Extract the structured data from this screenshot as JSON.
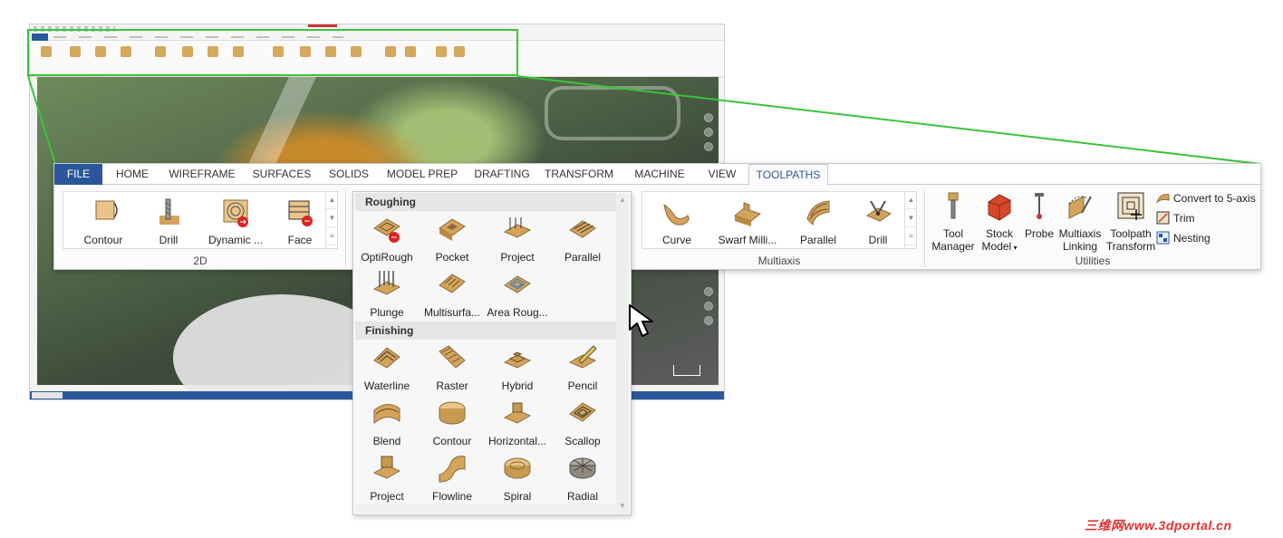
{
  "tabs": [
    "FILE",
    "HOME",
    "WIREFRAME",
    "SURFACES",
    "SOLIDS",
    "MODEL PREP",
    "DRAFTING",
    "TRANSFORM",
    "MACHINE",
    "VIEW",
    "TOOLPATHS"
  ],
  "groups": {
    "two_d": {
      "label": "2D",
      "buttons": [
        "Contour",
        "Drill",
        "Dynamic ...",
        "Face"
      ]
    },
    "multiaxis": {
      "label": "Multiaxis",
      "buttons": [
        "Curve",
        "Swarf Milli...",
        "Parallel",
        "Drill"
      ]
    },
    "utilities": {
      "label": "Utilities",
      "tool_manager": [
        "Tool",
        "Manager"
      ],
      "stock_model": [
        "Stock",
        "Model"
      ],
      "probe": "Probe",
      "multiaxis_linking": [
        "Multiaxis",
        "Linking"
      ],
      "toolpath_transform": [
        "Toolpath",
        "Transform"
      ],
      "small": [
        "Convert to 5-axis",
        "Trim",
        "Nesting"
      ]
    }
  },
  "dropdown": {
    "roughing_header": "Roughing",
    "roughing": [
      "OptiRough",
      "Pocket",
      "Project",
      "Parallel",
      "Plunge",
      "Multisurfa...",
      "Area Roug..."
    ],
    "finishing_header": "Finishing",
    "finishing": [
      "Waterline",
      "Raster",
      "Hybrid",
      "Pencil",
      "Blend",
      "Contour",
      "Horizontal...",
      "Scallop",
      "Project",
      "Flowline",
      "Spiral",
      "Radial"
    ]
  },
  "icons": {
    "accent": "#2b579a",
    "highlight": "#3bc43b",
    "part_tan": "#d4a35a"
  },
  "watermark": "三维网www.3dportal.cn"
}
